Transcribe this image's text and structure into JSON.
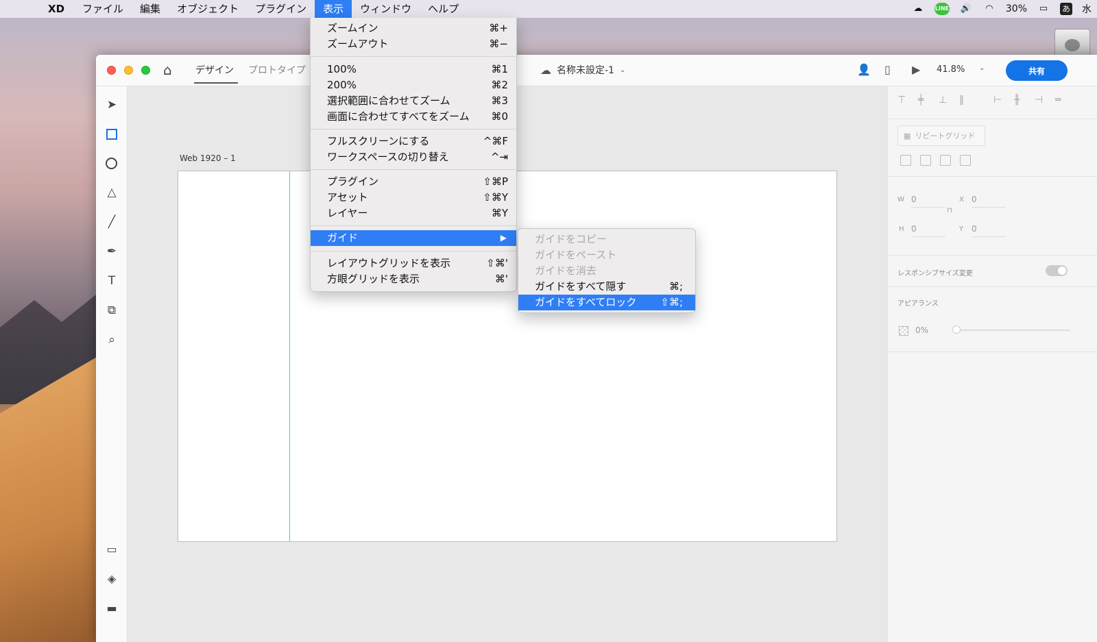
{
  "menubar": {
    "app_name": "XD",
    "items": [
      "ファイル",
      "編集",
      "オブジェクト",
      "プラグイン",
      "表示",
      "ウィンドウ",
      "ヘルプ"
    ],
    "active": "表示",
    "status": {
      "line_label": "LINE",
      "battery": "30%",
      "ime": "あ",
      "day": "水"
    }
  },
  "window": {
    "tabs": {
      "design": "デザイン",
      "prototype": "プロトタイプ"
    },
    "doc_title": "名称未設定-1",
    "zoom": "41.8%",
    "share": "共有"
  },
  "canvas": {
    "artboard_label": "Web 1920 – 1"
  },
  "panel": {
    "repeat_grid": "リピートグリッド",
    "w_label": "W",
    "w_val": "0",
    "h_label": "H",
    "h_val": "0",
    "x_label": "X",
    "x_val": "0",
    "y_label": "Y",
    "y_val": "0",
    "responsive": "レスポンシブサイズ変更",
    "appearance": "アピアランス",
    "opacity": "0%"
  },
  "view_menu": {
    "items": [
      {
        "label": "ズームイン",
        "shortcut": "⌘+"
      },
      {
        "label": "ズームアウト",
        "shortcut": "⌘−"
      },
      {
        "label": "100%",
        "shortcut": "⌘1"
      },
      {
        "label": "200%",
        "shortcut": "⌘2"
      },
      {
        "label": "選択範囲に合わせてズーム",
        "shortcut": "⌘3"
      },
      {
        "label": "画面に合わせてすべてをズーム",
        "shortcut": "⌘0"
      },
      {
        "label": "フルスクリーンにする",
        "shortcut": "^⌘F"
      },
      {
        "label": "ワークスペースの切り替え",
        "shortcut": "^⇥"
      },
      {
        "label": "プラグイン",
        "shortcut": "⇧⌘P"
      },
      {
        "label": "アセット",
        "shortcut": "⇧⌘Y"
      },
      {
        "label": "レイヤー",
        "shortcut": "⌘Y"
      },
      {
        "label": "ガイド",
        "shortcut": "▶"
      },
      {
        "label": "レイアウトグリッドを表示",
        "shortcut": "⇧⌘'"
      },
      {
        "label": "方眼グリッドを表示",
        "shortcut": "⌘'"
      }
    ]
  },
  "guide_submenu": {
    "items": [
      {
        "label": "ガイドをコピー",
        "shortcut": "",
        "disabled": true
      },
      {
        "label": "ガイドをペースト",
        "shortcut": "",
        "disabled": true
      },
      {
        "label": "ガイドを消去",
        "shortcut": "",
        "disabled": true
      },
      {
        "label": "ガイドをすべて隠す",
        "shortcut": "⌘;",
        "disabled": false
      },
      {
        "label": "ガイドをすべてロック",
        "shortcut": "⇧⌘;",
        "disabled": false
      }
    ]
  }
}
